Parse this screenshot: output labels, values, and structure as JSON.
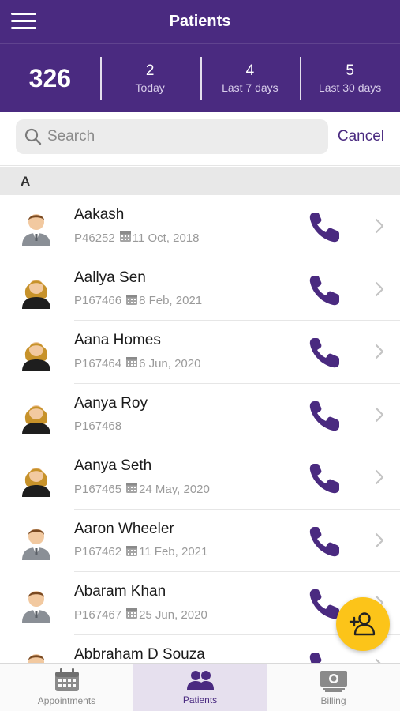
{
  "header": {
    "title": "Patients",
    "stats": [
      {
        "value": "326",
        "label": ""
      },
      {
        "value": "2",
        "label": "Today"
      },
      {
        "value": "4",
        "label": "Last 7 days"
      },
      {
        "value": "5",
        "label": "Last 30 days"
      }
    ]
  },
  "search": {
    "placeholder": "Search",
    "value": "",
    "cancel_label": "Cancel"
  },
  "section_letter": "A",
  "patients": [
    {
      "name": "Aakash",
      "id": "P46252",
      "date": "11 Oct, 2018",
      "gender": "male"
    },
    {
      "name": "Aallya Sen",
      "id": "P167466",
      "date": "8 Feb, 2021",
      "gender": "female"
    },
    {
      "name": "Aana Homes",
      "id": "P167464",
      "date": "6 Jun, 2020",
      "gender": "female"
    },
    {
      "name": "Aanya Roy",
      "id": "P167468",
      "date": "",
      "gender": "female"
    },
    {
      "name": "Aanya Seth",
      "id": "P167465",
      "date": "24 May, 2020",
      "gender": "female"
    },
    {
      "name": "Aaron Wheeler",
      "id": "P167462",
      "date": "11 Feb, 2021",
      "gender": "male"
    },
    {
      "name": "Abaram Khan",
      "id": "P167467",
      "date": "25 Jun, 2020",
      "gender": "male"
    },
    {
      "name": "Abbraham D Souza",
      "id": "",
      "date": "",
      "gender": "male"
    }
  ],
  "tabs": [
    {
      "label": "Appointments",
      "icon": "calendar-icon"
    },
    {
      "label": "Patients",
      "icon": "patients-icon"
    },
    {
      "label": "Billing",
      "icon": "billing-icon"
    }
  ],
  "colors": {
    "primary": "#4a2a80",
    "fab": "#fcc419",
    "avatar_female_hair": "#c7922a",
    "avatar_male_suit": "#8a8f96"
  }
}
